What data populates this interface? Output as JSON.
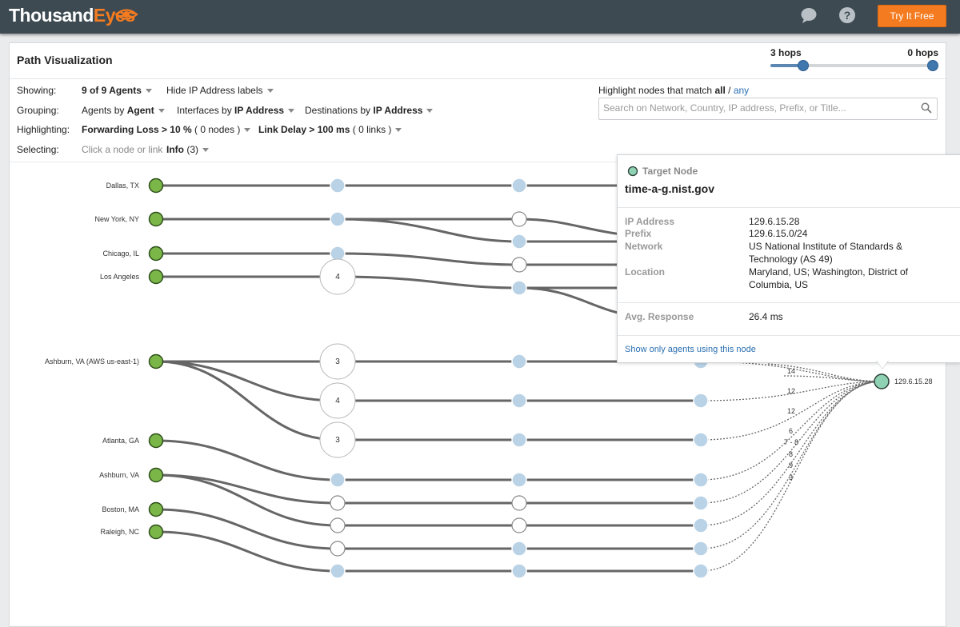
{
  "app": {
    "logo_text_a": "Thousand",
    "logo_text_b": "Eyes",
    "brand_color": "#f47b20",
    "try_button": "Try It Free"
  },
  "panel": {
    "title": "Path Visualization",
    "hops_left": "3 hops",
    "hops_right": "0 hops"
  },
  "controls": {
    "showing_label": "Showing:",
    "showing_agents": "9 of 9 Agents",
    "showing_ip": "Hide IP Address labels",
    "grouping_label": "Grouping:",
    "grouping_agents_pre": "Agents by",
    "grouping_agents_val": "Agent",
    "grouping_ifaces_pre": "Interfaces by",
    "grouping_ifaces_val": "IP Address",
    "grouping_dest_pre": "Destinations by",
    "grouping_dest_val": "IP Address",
    "highlighting_label": "Highlighting:",
    "hl_loss_b": "Forwarding Loss > 10 %",
    "hl_loss_rest": "( 0 nodes )",
    "hl_delay_b": "Link Delay > 100 ms",
    "hl_delay_rest": "( 0 links )",
    "selecting_label": "Selecting:",
    "selecting_hint": "Click a node or link",
    "selecting_info": "Info",
    "selecting_info_count": "(3)"
  },
  "highlight": {
    "prefix": "Highlight nodes that match",
    "all": "all",
    "slash": "/",
    "any": "any",
    "search_placeholder": "Search on Network, Country, IP address, Prefix, or Title..."
  },
  "agents": [
    "Dallas, TX",
    "New York, NY",
    "Chicago, IL",
    "Los Angeles",
    "Ashburn, VA (AWS us-east-1)",
    "Atlanta, GA",
    "Ashburn, VA",
    "Boston, MA",
    "Raleigh, NC"
  ],
  "group_nodes": [
    "4",
    "3",
    "4",
    "3"
  ],
  "edge_labels": [
    "14",
    "12",
    "12",
    "6",
    "7 - 8",
    "8",
    "9",
    "3"
  ],
  "target_label": "129.6.15.28",
  "popup": {
    "heading": "Target Node",
    "hostname": "time-a-g.nist.gov",
    "ip_key": "IP Address",
    "ip_val": "129.6.15.28",
    "prefix_key": "Prefix",
    "prefix_val": "129.6.15.0/24",
    "network_key": "Network",
    "network_val": "US National Institute of Standards & Technology (AS 49)",
    "location_key": "Location",
    "location_val": "Maryland, US; Washington, District of Columbia, US",
    "avg_key": "Avg. Response",
    "avg_val": "26.4 ms",
    "link": "Show only agents using this node"
  },
  "colors": {
    "agent_fill": "#7ab648",
    "hop_fill": "#b9d2e6",
    "target_fill": "#8fd1b3",
    "edge": "#666666"
  }
}
